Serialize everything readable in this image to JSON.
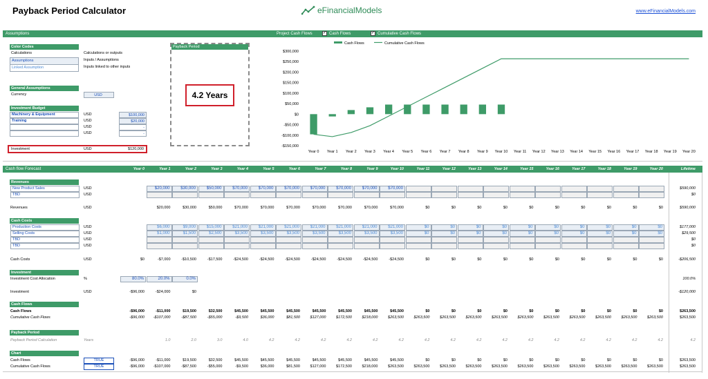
{
  "header": {
    "title": "Payback Period Calculator",
    "logo_text": "eFinancialModels",
    "website": "www.eFinancialModels.com"
  },
  "top_band": {
    "assumptions": "Assumptions",
    "project_cash_flows": "Project Cash Flows",
    "cb_cash_flows": "Cash Flows",
    "cb_cumulative": "Cumulative Cash Flows"
  },
  "color_codes": {
    "header": "Color Codes",
    "rows": [
      {
        "label": "Calculations",
        "desc": "Calculations or outputs"
      },
      {
        "label": "Assumptions",
        "desc": "Inputs / Assumptions"
      },
      {
        "label": "Linked Assumption",
        "desc": "Inputs linked to other inputs"
      }
    ]
  },
  "general": {
    "header": "General Assumptions",
    "currency_label": "Currency",
    "currency_value": "USD"
  },
  "budget": {
    "header": "Investment Budget",
    "rows": [
      {
        "label": "Machinery & Equipment",
        "unit": "USD",
        "value": "$100,000"
      },
      {
        "label": "Training",
        "unit": "USD",
        "value": "$20,000"
      },
      {
        "label": "",
        "unit": "USD",
        "value": "-"
      },
      {
        "label": "",
        "unit": "USD",
        "value": "-"
      }
    ],
    "total_label": "Investment",
    "total_unit": "USD",
    "total_value": "$120,000"
  },
  "payback_box": {
    "header": "Payback Period",
    "value": "4.2 Years"
  },
  "chart_data": {
    "type": "bar",
    "legend": [
      "Cash Flows",
      "Cumulative Cash Flows"
    ],
    "categories": [
      "Year 0",
      "Year 1",
      "Year 2",
      "Year 3",
      "Year 4",
      "Year 5",
      "Year 6",
      "Year 7",
      "Year 8",
      "Year 9",
      "Year 10",
      "Year 11",
      "Year 12",
      "Year 13",
      "Year 14",
      "Year 15",
      "Year 16",
      "Year 17",
      "Year 18",
      "Year 19",
      "Year 20"
    ],
    "series": [
      {
        "name": "Cash Flows",
        "type": "bar",
        "values": [
          -96000,
          -11000,
          19500,
          32500,
          45500,
          45500,
          45500,
          45500,
          45500,
          45500,
          45500,
          0,
          0,
          0,
          0,
          0,
          0,
          0,
          0,
          0,
          0
        ]
      },
      {
        "name": "Cumulative Cash Flows",
        "type": "line",
        "values": [
          -96000,
          -107000,
          -87500,
          -55000,
          -9500,
          36000,
          81500,
          127000,
          172500,
          218000,
          263500,
          263500,
          263500,
          263500,
          263500,
          263500,
          263500,
          263500,
          263500,
          263500,
          263500
        ]
      }
    ],
    "yticks": [
      "$300,000",
      "$250,000",
      "$200,000",
      "$150,000",
      "$100,000",
      "$50,000",
      "$0",
      "-$50,000",
      "-$100,000",
      "-$150,000"
    ],
    "ylim": [
      -150000,
      300000
    ],
    "colors": {
      "bar": "#3e9b68",
      "line": "#3e9b68"
    }
  },
  "forecast": {
    "band_label": "Cash flow Forecast",
    "years": [
      "Year 0",
      "Year 1",
      "Year 2",
      "Year 3",
      "Year 4",
      "Year 5",
      "Year 6",
      "Year 7",
      "Year 8",
      "Year 9",
      "Year 10",
      "Year 11",
      "Year 12",
      "Year 13",
      "Year 14",
      "Year 15",
      "Year 16",
      "Year 17",
      "Year 18",
      "Year 19",
      "Year 20"
    ],
    "lifetime_label": "Lifetime",
    "revenues_header": "Revenues",
    "rev_rows": [
      {
        "label": "New Product Sales",
        "unit": "USD",
        "values": [
          "$20,000",
          "$30,000",
          "$50,000",
          "$70,000",
          "$70,000",
          "$70,000",
          "$70,000",
          "$70,000",
          "$70,000",
          "$70,000",
          "",
          "",
          "",
          "",
          "",
          "",
          "",
          "",
          "",
          ""
        ],
        "lifetime": "$590,000"
      },
      {
        "label": "TBD",
        "unit": "USD",
        "values": [
          "",
          "",
          "",
          "",
          "",
          "",
          "",
          "",
          "",
          "",
          "",
          "",
          "",
          "",
          "",
          "",
          "",
          "",
          "",
          ""
        ],
        "lifetime": "$0"
      }
    ],
    "revenues_total": {
      "label": "Revenues",
      "unit": "USD",
      "values": [
        "",
        "$20,000",
        "$30,000",
        "$50,000",
        "$70,000",
        "$70,000",
        "$70,000",
        "$70,000",
        "$70,000",
        "$70,000",
        "$70,000",
        "$0",
        "$0",
        "$0",
        "$0",
        "$0",
        "$0",
        "$0",
        "$0",
        "$0",
        "$0"
      ],
      "lifetime": "$590,000"
    },
    "costs_header": "Cash Costs",
    "cost_rows": [
      {
        "label": "Production Costs",
        "unit": "USD",
        "values": [
          "$6,000",
          "$9,000",
          "$15,000",
          "$21,000",
          "$21,000",
          "$21,000",
          "$21,000",
          "$21,000",
          "$21,000",
          "$21,000",
          "$0",
          "$0",
          "$0",
          "$0",
          "$0",
          "$0",
          "$0",
          "$0",
          "$0",
          "$0"
        ],
        "lifetime": "$177,000"
      },
      {
        "label": "Selling Costs",
        "unit": "USD",
        "values": [
          "$1,000",
          "$1,500",
          "$2,500",
          "$3,500",
          "$3,500",
          "$3,500",
          "$3,500",
          "$3,500",
          "$3,500",
          "$3,500",
          "$0",
          "$0",
          "$0",
          "$0",
          "$0",
          "$0",
          "$0",
          "$0",
          "$0",
          "$0"
        ],
        "lifetime": "$29,500"
      },
      {
        "label": "TBD",
        "unit": "USD",
        "values": [
          "",
          "",
          "",
          "",
          "",
          "",
          "",
          "",
          "",
          "",
          "",
          "",
          "",
          "",
          "",
          "",
          "",
          "",
          "",
          ""
        ],
        "lifetime": "$0"
      },
      {
        "label": "TBD",
        "unit": "USD",
        "values": [
          "",
          "",
          "",
          "",
          "",
          "",
          "",
          "",
          "",
          "",
          "",
          "",
          "",
          "",
          "",
          "",
          "",
          "",
          "",
          ""
        ],
        "lifetime": "$0"
      }
    ],
    "costs_total": {
      "label": "Cash Costs",
      "unit": "USD",
      "values": [
        "$0",
        "-$7,000",
        "-$10,500",
        "-$17,500",
        "-$24,500",
        "-$24,500",
        "-$24,500",
        "-$24,500",
        "-$24,500",
        "-$24,500",
        "-$24,500",
        "$0",
        "$0",
        "$0",
        "$0",
        "$0",
        "$0",
        "$0",
        "$0",
        "$0",
        "$0"
      ],
      "lifetime": "-$206,500"
    },
    "investment_header": "Investment",
    "alloc": {
      "label": "Investment Cost Allocation",
      "unit": "%",
      "values": [
        "80.0%",
        "20.0%",
        "0.0%"
      ],
      "lifetime": "100.0%"
    },
    "investment_row": {
      "label": "Investment",
      "unit": "USD",
      "values": [
        "-$96,000",
        "-$24,000",
        "$0"
      ],
      "lifetime": "-$120,000"
    },
    "cashflows_header": "Cash Flows",
    "cashflows": {
      "label": "Cash Flows",
      "values": [
        "-$96,000",
        "-$11,000",
        "$19,500",
        "$32,500",
        "$45,500",
        "$45,500",
        "$45,500",
        "$45,500",
        "$45,500",
        "$45,500",
        "$45,500",
        "$0",
        "$0",
        "$0",
        "$0",
        "$0",
        "$0",
        "$0",
        "$0",
        "$0",
        "$0"
      ],
      "lifetime": "$263,500"
    },
    "cumulative": {
      "label": "Cumulative Cash Flows",
      "values": [
        "-$96,000",
        "-$107,000",
        "-$87,500",
        "-$55,000",
        "-$9,500",
        "$36,000",
        "$81,500",
        "$127,000",
        "$172,500",
        "$218,000",
        "$263,500",
        "$263,500",
        "$263,500",
        "$263,500",
        "$263,500",
        "$263,500",
        "$263,500",
        "$263,500",
        "$263,500",
        "$263,500",
        "$263,500"
      ],
      "lifetime": "$263,500"
    },
    "payback_header": "Payback Period",
    "payback": {
      "label": "Payback Period Calculation",
      "unit": "Years",
      "values": [
        "",
        "1.0",
        "2.0",
        "3.0",
        "4.0",
        "4.2",
        "4.2",
        "4.2",
        "4.2",
        "4.2",
        "4.2",
        "4.2",
        "4.2",
        "4.2",
        "4.2",
        "4.2",
        "4.2",
        "4.2",
        "4.2",
        "4.2",
        "4.2"
      ],
      "lifetime": "4.2"
    },
    "chart_header": "Chart",
    "chart_rows": [
      {
        "label": "Cash Flows",
        "flag": "TRUE",
        "values": [
          "-$96,000",
          "-$11,000",
          "$19,500",
          "$32,500",
          "$45,500",
          "$45,500",
          "$45,500",
          "$45,500",
          "$45,500",
          "$45,500",
          "$45,500",
          "$0",
          "$0",
          "$0",
          "$0",
          "$0",
          "$0",
          "$0",
          "$0",
          "$0",
          "$0"
        ],
        "lifetime": "$263,500"
      },
      {
        "label": "Cumulative Cash Flows",
        "flag": "TRUE",
        "values": [
          "-$96,000",
          "-$107,000",
          "-$87,500",
          "-$55,000",
          "-$9,500",
          "$36,000",
          "$81,500",
          "$127,000",
          "$172,500",
          "$218,000",
          "$263,500",
          "$263,500",
          "$263,500",
          "$263,500",
          "$263,500",
          "$263,500",
          "$263,500",
          "$263,500",
          "$263,500",
          "$263,500",
          "$263,500"
        ],
        "lifetime": "$263,500"
      }
    ]
  }
}
